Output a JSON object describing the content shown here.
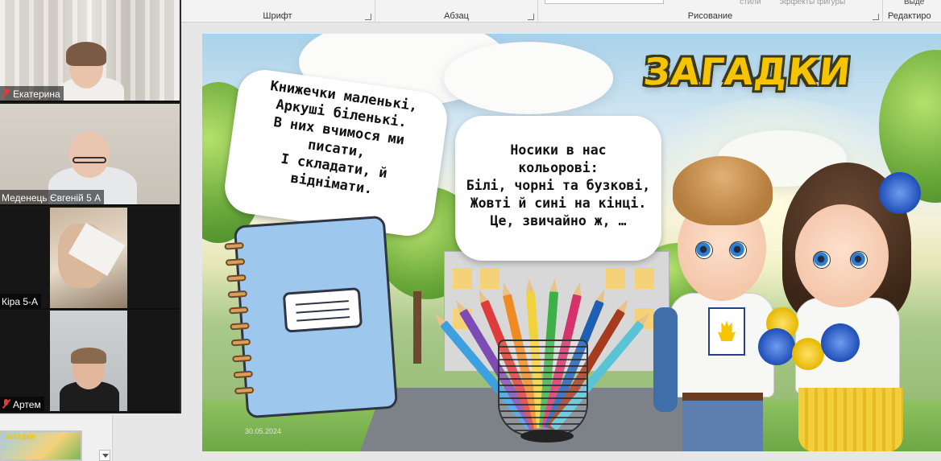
{
  "ribbon": {
    "groups": [
      "Шрифт",
      "Абзац",
      "Рисование",
      "Редактиро"
    ],
    "faded_left": "стили",
    "faded_right": "эффекты фигуры",
    "faded_far": "Выде"
  },
  "participants": [
    {
      "name": "Екатерина",
      "muted": true
    },
    {
      "name": "Меденець Євгеній 5 А",
      "muted": false
    },
    {
      "name": "Кіра 5-А",
      "muted": false
    },
    {
      "name": "Артем",
      "muted": true
    }
  ],
  "slide_panel": {
    "thumbnail_title": "ЗАГАДКИ"
  },
  "slide": {
    "title": "ЗАГАДКИ",
    "riddle1": [
      "Книжечки маленькі,",
      "Аркуші біленькі.",
      "В них вчимося ми",
      "писати,",
      "І складати, й",
      "віднімати."
    ],
    "riddle2": [
      "Носики в нас",
      "кольорові:",
      "Білі, чорні та бузкові,",
      "Жовті й сині на кінці.",
      "Це, звичайно ж, …"
    ],
    "date_watermark": "30.05.2024"
  },
  "colors": {
    "title_yellow": "#f6c400",
    "notebook_blue": "#9ec7ee",
    "ribbon_bg": "#f3f3f3",
    "gallery_bg": "#1a1a1a"
  },
  "pencil_colors": [
    "#3da0e0",
    "#7c4bb3",
    "#e03b3b",
    "#f08a24",
    "#f2d23a",
    "#3db04a",
    "#d6336c",
    "#1e5fb4",
    "#a63b1e",
    "#58c4d6"
  ]
}
